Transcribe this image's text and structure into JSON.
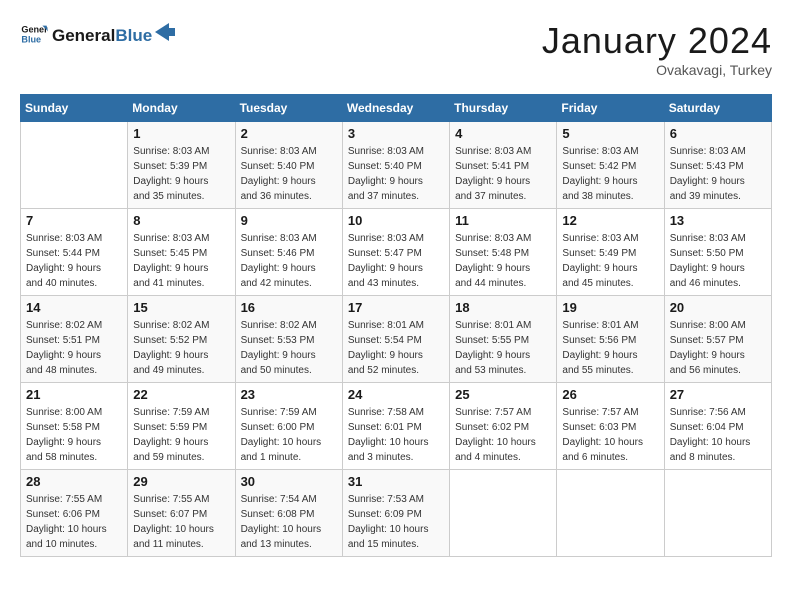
{
  "header": {
    "logo_line1": "General",
    "logo_line2": "Blue",
    "month": "January 2024",
    "location": "Ovakavagi, Turkey"
  },
  "days_of_week": [
    "Sunday",
    "Monday",
    "Tuesday",
    "Wednesday",
    "Thursday",
    "Friday",
    "Saturday"
  ],
  "weeks": [
    [
      {
        "day": "",
        "info": ""
      },
      {
        "day": "1",
        "info": "Sunrise: 8:03 AM\nSunset: 5:39 PM\nDaylight: 9 hours\nand 35 minutes."
      },
      {
        "day": "2",
        "info": "Sunrise: 8:03 AM\nSunset: 5:40 PM\nDaylight: 9 hours\nand 36 minutes."
      },
      {
        "day": "3",
        "info": "Sunrise: 8:03 AM\nSunset: 5:40 PM\nDaylight: 9 hours\nand 37 minutes."
      },
      {
        "day": "4",
        "info": "Sunrise: 8:03 AM\nSunset: 5:41 PM\nDaylight: 9 hours\nand 37 minutes."
      },
      {
        "day": "5",
        "info": "Sunrise: 8:03 AM\nSunset: 5:42 PM\nDaylight: 9 hours\nand 38 minutes."
      },
      {
        "day": "6",
        "info": "Sunrise: 8:03 AM\nSunset: 5:43 PM\nDaylight: 9 hours\nand 39 minutes."
      }
    ],
    [
      {
        "day": "7",
        "info": "Sunrise: 8:03 AM\nSunset: 5:44 PM\nDaylight: 9 hours\nand 40 minutes."
      },
      {
        "day": "8",
        "info": "Sunrise: 8:03 AM\nSunset: 5:45 PM\nDaylight: 9 hours\nand 41 minutes."
      },
      {
        "day": "9",
        "info": "Sunrise: 8:03 AM\nSunset: 5:46 PM\nDaylight: 9 hours\nand 42 minutes."
      },
      {
        "day": "10",
        "info": "Sunrise: 8:03 AM\nSunset: 5:47 PM\nDaylight: 9 hours\nand 43 minutes."
      },
      {
        "day": "11",
        "info": "Sunrise: 8:03 AM\nSunset: 5:48 PM\nDaylight: 9 hours\nand 44 minutes."
      },
      {
        "day": "12",
        "info": "Sunrise: 8:03 AM\nSunset: 5:49 PM\nDaylight: 9 hours\nand 45 minutes."
      },
      {
        "day": "13",
        "info": "Sunrise: 8:03 AM\nSunset: 5:50 PM\nDaylight: 9 hours\nand 46 minutes."
      }
    ],
    [
      {
        "day": "14",
        "info": "Sunrise: 8:02 AM\nSunset: 5:51 PM\nDaylight: 9 hours\nand 48 minutes."
      },
      {
        "day": "15",
        "info": "Sunrise: 8:02 AM\nSunset: 5:52 PM\nDaylight: 9 hours\nand 49 minutes."
      },
      {
        "day": "16",
        "info": "Sunrise: 8:02 AM\nSunset: 5:53 PM\nDaylight: 9 hours\nand 50 minutes."
      },
      {
        "day": "17",
        "info": "Sunrise: 8:01 AM\nSunset: 5:54 PM\nDaylight: 9 hours\nand 52 minutes."
      },
      {
        "day": "18",
        "info": "Sunrise: 8:01 AM\nSunset: 5:55 PM\nDaylight: 9 hours\nand 53 minutes."
      },
      {
        "day": "19",
        "info": "Sunrise: 8:01 AM\nSunset: 5:56 PM\nDaylight: 9 hours\nand 55 minutes."
      },
      {
        "day": "20",
        "info": "Sunrise: 8:00 AM\nSunset: 5:57 PM\nDaylight: 9 hours\nand 56 minutes."
      }
    ],
    [
      {
        "day": "21",
        "info": "Sunrise: 8:00 AM\nSunset: 5:58 PM\nDaylight: 9 hours\nand 58 minutes."
      },
      {
        "day": "22",
        "info": "Sunrise: 7:59 AM\nSunset: 5:59 PM\nDaylight: 9 hours\nand 59 minutes."
      },
      {
        "day": "23",
        "info": "Sunrise: 7:59 AM\nSunset: 6:00 PM\nDaylight: 10 hours\nand 1 minute."
      },
      {
        "day": "24",
        "info": "Sunrise: 7:58 AM\nSunset: 6:01 PM\nDaylight: 10 hours\nand 3 minutes."
      },
      {
        "day": "25",
        "info": "Sunrise: 7:57 AM\nSunset: 6:02 PM\nDaylight: 10 hours\nand 4 minutes."
      },
      {
        "day": "26",
        "info": "Sunrise: 7:57 AM\nSunset: 6:03 PM\nDaylight: 10 hours\nand 6 minutes."
      },
      {
        "day": "27",
        "info": "Sunrise: 7:56 AM\nSunset: 6:04 PM\nDaylight: 10 hours\nand 8 minutes."
      }
    ],
    [
      {
        "day": "28",
        "info": "Sunrise: 7:55 AM\nSunset: 6:06 PM\nDaylight: 10 hours\nand 10 minutes."
      },
      {
        "day": "29",
        "info": "Sunrise: 7:55 AM\nSunset: 6:07 PM\nDaylight: 10 hours\nand 11 minutes."
      },
      {
        "day": "30",
        "info": "Sunrise: 7:54 AM\nSunset: 6:08 PM\nDaylight: 10 hours\nand 13 minutes."
      },
      {
        "day": "31",
        "info": "Sunrise: 7:53 AM\nSunset: 6:09 PM\nDaylight: 10 hours\nand 15 minutes."
      },
      {
        "day": "",
        "info": ""
      },
      {
        "day": "",
        "info": ""
      },
      {
        "day": "",
        "info": ""
      }
    ]
  ]
}
